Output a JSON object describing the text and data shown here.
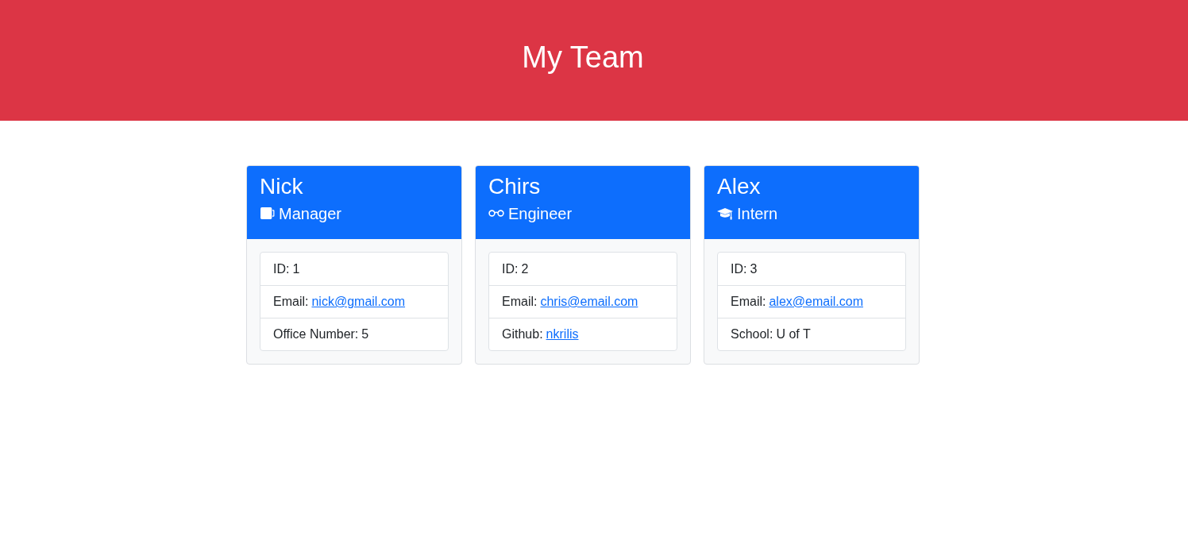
{
  "header": {
    "title": "My Team"
  },
  "members": [
    {
      "name": "Nick",
      "role": "Manager",
      "kind": "manager",
      "details": [
        {
          "kind": "text",
          "label": "ID:",
          "value": "1"
        },
        {
          "kind": "link",
          "label": "Email:",
          "value": "nick@gmail.com"
        },
        {
          "kind": "text",
          "label": "Office Number:",
          "value": "5"
        }
      ]
    },
    {
      "name": "Chirs",
      "role": "Engineer",
      "kind": "engineer",
      "details": [
        {
          "kind": "text",
          "label": "ID:",
          "value": "2"
        },
        {
          "kind": "link",
          "label": "Email:",
          "value": "chris@email.com"
        },
        {
          "kind": "link",
          "label": "Github:",
          "value": "nkrilis"
        }
      ]
    },
    {
      "name": "Alex",
      "role": "Intern",
      "kind": "intern",
      "details": [
        {
          "kind": "text",
          "label": "ID:",
          "value": "3"
        },
        {
          "kind": "link",
          "label": "Email:",
          "value": "alex@email.com"
        },
        {
          "kind": "text",
          "label": "School:",
          "value": "U of T"
        }
      ]
    }
  ]
}
